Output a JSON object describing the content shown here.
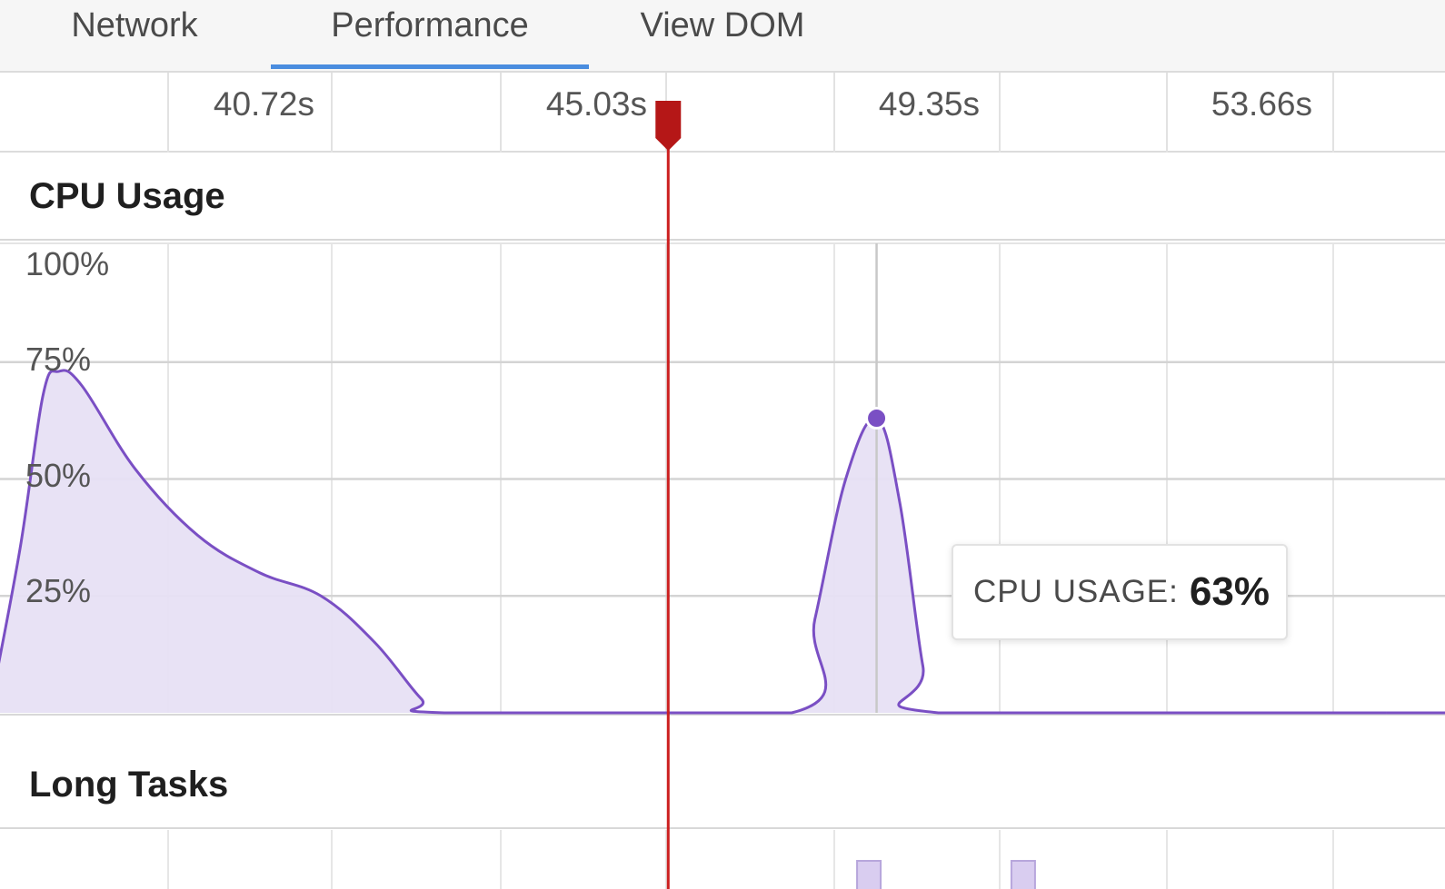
{
  "tabs": [
    {
      "label": "Network",
      "active": false
    },
    {
      "label": "Performance",
      "active": true
    },
    {
      "label": "View DOM",
      "active": false
    }
  ],
  "timeline": {
    "tick_labels": [
      "40.72s",
      "45.03s",
      "49.35s",
      "53.66s"
    ]
  },
  "cpu_section": {
    "title": "CPU Usage",
    "y_ticks": [
      "100%",
      "75%",
      "50%",
      "25%"
    ],
    "tooltip": {
      "label": "CPU USAGE:",
      "value": "63%"
    }
  },
  "long_tasks_section": {
    "title": "Long Tasks"
  },
  "colors": {
    "accent_tab": "#4a8ddf",
    "cpu_line": "#7a4fc4",
    "cpu_fill": "#e7e0f4",
    "playhead": "#cc1f1f",
    "long_task_fill": "#d9cdf0"
  },
  "chart_data": {
    "type": "area",
    "title": "CPU Usage",
    "ylim": [
      0,
      100
    ],
    "y_ticks": [
      25,
      50,
      75,
      100
    ],
    "x_ticks_seconds": [
      40.72,
      45.03,
      49.35,
      53.66
    ],
    "series": [
      {
        "name": "CPU Usage",
        "points": [
          [
            38.4,
            0
          ],
          [
            38.8,
            35
          ],
          [
            39.1,
            68
          ],
          [
            39.3,
            73
          ],
          [
            39.6,
            70
          ],
          [
            40.3,
            52
          ],
          [
            41.1,
            38
          ],
          [
            41.9,
            30
          ],
          [
            42.7,
            25
          ],
          [
            43.4,
            15
          ],
          [
            44.0,
            3
          ],
          [
            44.3,
            0
          ],
          [
            48.8,
            0
          ],
          [
            49.1,
            20
          ],
          [
            49.5,
            50
          ],
          [
            49.9,
            63
          ],
          [
            50.2,
            45
          ],
          [
            50.5,
            10
          ],
          [
            50.7,
            0
          ],
          [
            56.5,
            0
          ]
        ]
      }
    ],
    "highlight_point": {
      "x": 49.9,
      "y": 63
    },
    "playhead_seconds": 47.2,
    "long_tasks_seconds": [
      49.8,
      51.8
    ]
  }
}
